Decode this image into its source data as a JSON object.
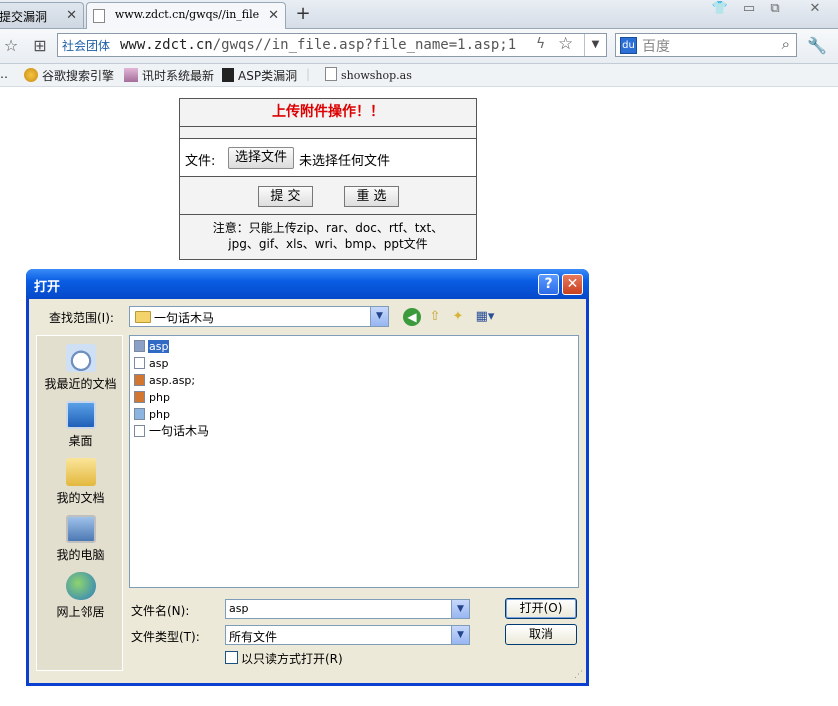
{
  "browser": {
    "tabs": [
      {
        "title": "提交漏洞",
        "active": false
      },
      {
        "title": "www.zdct.cn/gwqs//in_file",
        "active": true
      }
    ],
    "new_tab_label": "+",
    "address": {
      "site_tag": "社会团体",
      "url_host": "www.zdct.cn",
      "url_path": "/gwqs//in_file.asp?file_name=1.asp;1"
    },
    "search": {
      "engine_icon": "du",
      "placeholder": "百度"
    },
    "bookmarks": [
      {
        "label": "谷歌搜索引擎"
      },
      {
        "label": "讯时系统最新"
      },
      {
        "label": "ASP类漏洞"
      },
      {
        "label": "showshop.as"
      }
    ]
  },
  "upload_form": {
    "title": "上传附件操作！！",
    "file_label": "文件:",
    "choose_button": "选择文件",
    "no_file_text": "未选择任何文件",
    "submit_button": "提 交",
    "reset_button": "重 选",
    "note_line1": "注意：只能上传zip、rar、doc、rtf、txt、",
    "note_line2": "jpg、gif、xls、wri、bmp、ppt文件"
  },
  "dialog": {
    "title": "打开",
    "help_label": "?",
    "close_label": "✕",
    "look_in_label": "查找范围(I):",
    "look_in_value": "一句话木马",
    "places": [
      {
        "label": "我最近的文档"
      },
      {
        "label": "桌面"
      },
      {
        "label": "我的文档"
      },
      {
        "label": "我的电脑"
      },
      {
        "label": "网上邻居"
      }
    ],
    "files": [
      {
        "name": "asp",
        "selected": true
      },
      {
        "name": "asp",
        "selected": false
      },
      {
        "name": "asp.asp;",
        "selected": false
      },
      {
        "name": "php",
        "selected": false
      },
      {
        "name": "php",
        "selected": false
      },
      {
        "name": "一句话木马",
        "selected": false
      }
    ],
    "file_name_label": "文件名(N):",
    "file_name_value": "asp",
    "file_type_label": "文件类型(T):",
    "file_type_value": "所有文件",
    "open_button": "打开(O)",
    "cancel_button": "取消",
    "readonly_label": "以只读方式打开(R)"
  }
}
